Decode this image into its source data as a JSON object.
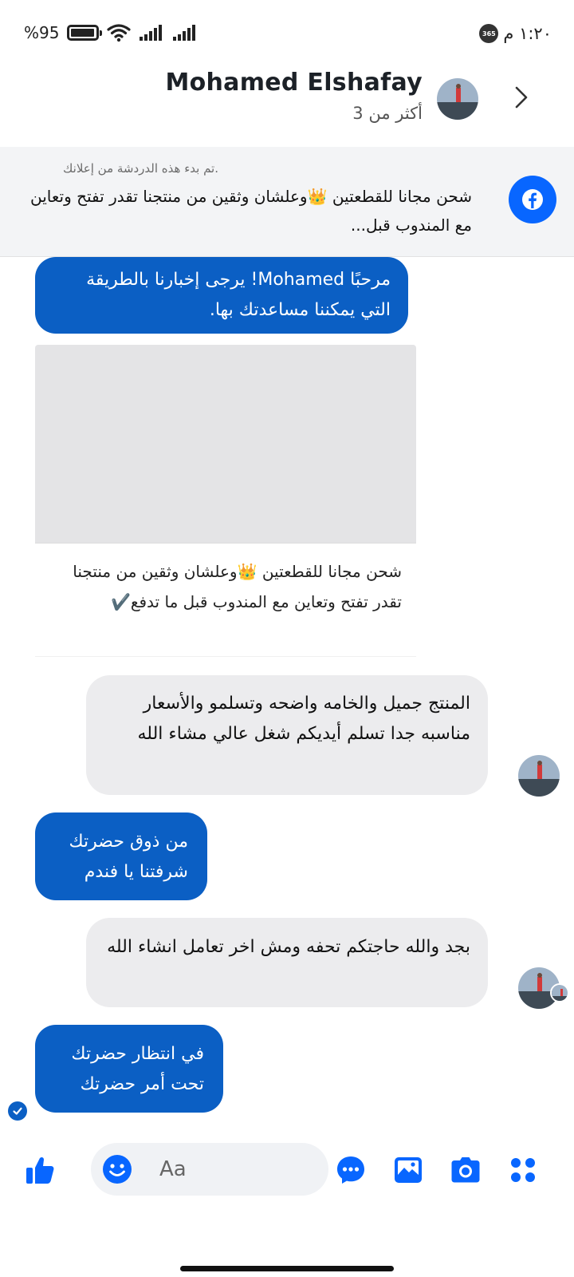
{
  "status_bar": {
    "time": "١:٢٠ م",
    "badge": "365",
    "battery_text": "%95",
    "battery_level": 0.95
  },
  "header": {
    "title": "Mohamed Elshafay",
    "subtitle": "أكثر من 3"
  },
  "ad_banner": {
    "note": ".تم بدء هذه الدردشة من إعلانك",
    "text": "شحن مجانا للقطعتين 👑وعلشان وثقين من منتجنا تقدر تفتح وتعاين مع المندوب قبل..."
  },
  "messages": [
    {
      "type": "out",
      "text": "مرحبًا Mohamed! يرجى إخبارنا بالطريقة التي يمكننا مساعدتك بها."
    },
    {
      "type": "card",
      "caption": "شحن مجانا للقطعتين 👑وعلشان وثقين من منتجنا تقدر تفتح وتعاين مع المندوب قبل ما تدفع✔️"
    },
    {
      "type": "in",
      "text": "المنتج جميل والخامه واضحه وتسلمو والأسعار مناسبه جدا تسلم أيديكم شغل عالي مشاء الله"
    },
    {
      "type": "out",
      "text": "من ذوق حضرتك شرفتنا يا فندم"
    },
    {
      "type": "in",
      "text": "بجد والله حاجتكم تحفه ومش اخر تعامل انشاء الله"
    },
    {
      "type": "out",
      "text": "في انتظار حضرتك تحت أمر حضرتك"
    }
  ],
  "composer": {
    "placeholder": "Aa"
  },
  "colors": {
    "outgoing_bubble": "#0b5fc4",
    "incoming_bubble": "#ececee",
    "icon_blue": "#0866ff"
  },
  "icons": [
    "like-icon",
    "emoji-icon",
    "chat-icon",
    "gallery-icon",
    "camera-icon",
    "apps-icon",
    "back-chevron-icon",
    "facebook-icon",
    "seen-check-icon"
  ]
}
